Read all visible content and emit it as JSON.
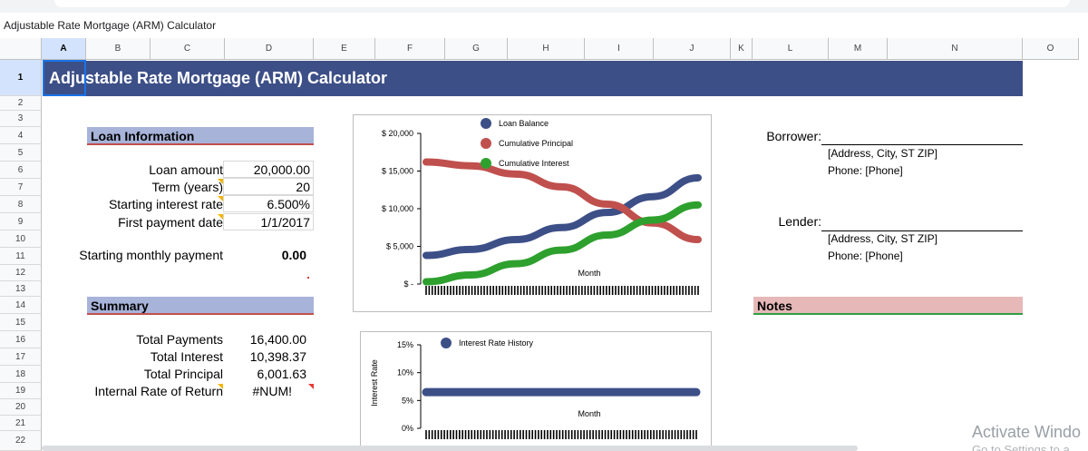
{
  "window": {
    "title": "Adjustable Rate Mortgage (ARM) Calculator"
  },
  "columns": [
    "A",
    "B",
    "C",
    "D",
    "E",
    "F",
    "G",
    "H",
    "I",
    "J",
    "K",
    "L",
    "M",
    "N",
    "O"
  ],
  "rows": [
    "1",
    "2",
    "3",
    "4",
    "5",
    "6",
    "7",
    "8",
    "9",
    "10",
    "11",
    "12",
    "13",
    "14",
    "15",
    "16",
    "17",
    "18",
    "19",
    "20",
    "21",
    "22"
  ],
  "selected_cell": "A1",
  "banner": {
    "title": "Adjustable Rate Mortgage (ARM) Calculator"
  },
  "loan_info": {
    "heading": "Loan Information",
    "loan_amount_label": "Loan amount",
    "loan_amount": "20,000.00",
    "term_label": "Term (years)",
    "term": "20",
    "rate_label": "Starting interest rate",
    "rate": "6.500%",
    "first_payment_label": "First payment date",
    "first_payment": "1/1/2017",
    "monthly_label": "Starting monthly payment",
    "monthly": "0.00"
  },
  "summary": {
    "heading": "Summary",
    "total_payments_label": "Total Payments",
    "total_payments": "16,400.00",
    "total_interest_label": "Total Interest",
    "total_interest": "10,398.37",
    "total_principal_label": "Total Principal",
    "total_principal": "6,001.63",
    "irr_label": "Internal Rate of Return",
    "irr": "#NUM!"
  },
  "borrower": {
    "label": "Borrower:",
    "address": "[Address, City, ST ZIP]",
    "phone": "Phone: [Phone]"
  },
  "lender": {
    "label": "Lender:",
    "address": "[Address, City, ST ZIP]",
    "phone": "Phone: [Phone]"
  },
  "notes": {
    "heading": "Notes"
  },
  "watermark": {
    "line1": "Activate Windo",
    "line2": "Go to Settings to a"
  },
  "colors": {
    "banner": "#3d4f87",
    "section": "#a7b3d9",
    "balance": "#3d4f87",
    "principal": "#c0504d",
    "interest": "#2ea02e",
    "rate": "#3d4f87"
  },
  "chart_data": [
    {
      "type": "line",
      "xlabel": "Month",
      "yticks": [
        "$ 20,000",
        "$ 15,000",
        "$ 10,000",
        "$ 5,000",
        "$ -"
      ],
      "ylim": [
        0,
        20000
      ],
      "xlim": [
        1,
        240
      ],
      "series": [
        {
          "name": "Loan Balance",
          "x": [
            1,
            40,
            80,
            120,
            160,
            200,
            240
          ],
          "y": [
            3800,
            4600,
            5900,
            7500,
            9500,
            11600,
            14100
          ]
        },
        {
          "name": "Cumulative Principal",
          "x": [
            1,
            40,
            80,
            120,
            160,
            200,
            240
          ],
          "y": [
            16200,
            15700,
            14600,
            12900,
            10600,
            8100,
            5900
          ]
        },
        {
          "name": "Cumulative Interest",
          "x": [
            1,
            40,
            80,
            120,
            160,
            200,
            240
          ],
          "y": [
            300,
            1200,
            2700,
            4500,
            6500,
            8500,
            10500
          ]
        }
      ]
    },
    {
      "type": "line",
      "xlabel": "Month",
      "ylabel": "Interest Rate",
      "yticks": [
        "15%",
        "10%",
        "5%",
        "0%"
      ],
      "ylim": [
        0,
        15
      ],
      "xlim": [
        1,
        240
      ],
      "series": [
        {
          "name": "Interest Rate History",
          "x": [
            1,
            240
          ],
          "y": [
            6.5,
            6.5
          ]
        }
      ]
    }
  ]
}
